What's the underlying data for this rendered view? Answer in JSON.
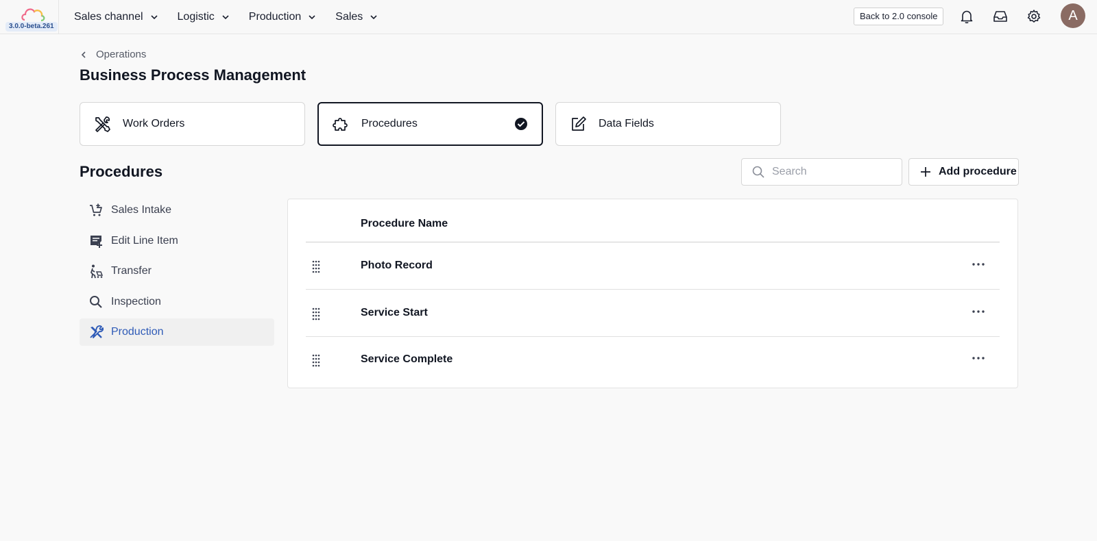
{
  "app": {
    "version": "3.0.0-beta.261",
    "back_button": "Back to 2.0 console",
    "avatar_initial": "A",
    "nav": [
      {
        "label": "Sales channel"
      },
      {
        "label": "Logistic"
      },
      {
        "label": "Production"
      },
      {
        "label": "Sales"
      }
    ]
  },
  "breadcrumb": {
    "label": "Operations"
  },
  "page": {
    "title": "Business Process Management"
  },
  "cards": [
    {
      "label": "Work Orders",
      "icon": "tools-icon"
    },
    {
      "label": "Procedures",
      "icon": "puzzle-icon",
      "selected": true
    },
    {
      "label": "Data Fields",
      "icon": "edit-icon"
    }
  ],
  "section": {
    "title": "Procedures"
  },
  "search": {
    "placeholder": "Search"
  },
  "add_button": {
    "label": "Add procedure"
  },
  "side_list": [
    {
      "label": "Sales Intake",
      "icon": "cart-add-icon"
    },
    {
      "label": "Edit Line Item",
      "icon": "edit-note-icon"
    },
    {
      "label": "Transfer",
      "icon": "transfer-icon"
    },
    {
      "label": "Inspection",
      "icon": "search-icon"
    },
    {
      "label": "Production",
      "icon": "tools-icon",
      "active": true
    }
  ],
  "table": {
    "header": "Procedure Name",
    "rows": [
      {
        "name": "Photo Record"
      },
      {
        "name": "Service Start"
      },
      {
        "name": "Service Complete"
      }
    ]
  },
  "colors": {
    "accent": "#2f5bb7",
    "avatar": "#8a6b63",
    "text": "#111622"
  }
}
